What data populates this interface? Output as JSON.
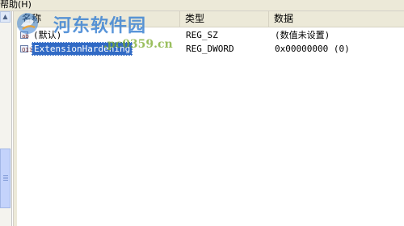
{
  "menubar": {
    "help_label": "帮助(H)"
  },
  "columns": {
    "name": "名称",
    "type": "类型",
    "data": "数据"
  },
  "rows": [
    {
      "name": "(默认)",
      "type": "REG_SZ",
      "data": "(数值未设置)",
      "icon": "string-value-icon",
      "icon_glyph": "ab"
    },
    {
      "name": "ExtensionHardening",
      "type": "REG_DWORD",
      "data": "0x00000000 (0)",
      "icon": "dword-value-icon",
      "icon_glyph": "011",
      "selected": true
    }
  ],
  "watermark": {
    "title": "河东软件园",
    "url": ".pc0359.cn"
  },
  "colors": {
    "selection": "#316ac5",
    "header_bg": "#ece9d8",
    "scroll_thumb": "#c4d3fb"
  }
}
